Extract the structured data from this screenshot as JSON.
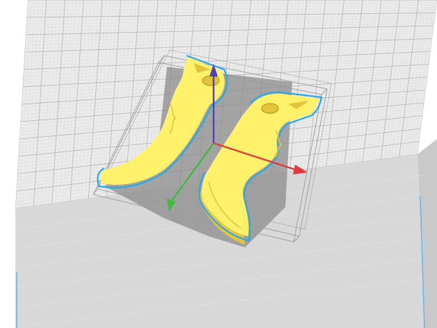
{
  "viewport": {
    "background_color": "#ffffff",
    "plate_color": "#ebebeb",
    "plate_side_color": "#c9c9c9",
    "plate_front_color": "#d8d8d8",
    "grid_color": "#bcbcbc",
    "fine_grid_color": "#dddddd",
    "border_color": "#5fb8ec"
  },
  "model": {
    "body_color": "#f5e150",
    "top_color": "#fff16a",
    "side_color": "#e2c53c",
    "outline_color": "#29a8e4",
    "shadow_color": "#8c8c8c",
    "selection_box_color": "#9a9a9a"
  },
  "axes": {
    "x_color": "#e23a3a",
    "y_color": "#3dbb3d",
    "z_color": "#4f3fbf"
  }
}
